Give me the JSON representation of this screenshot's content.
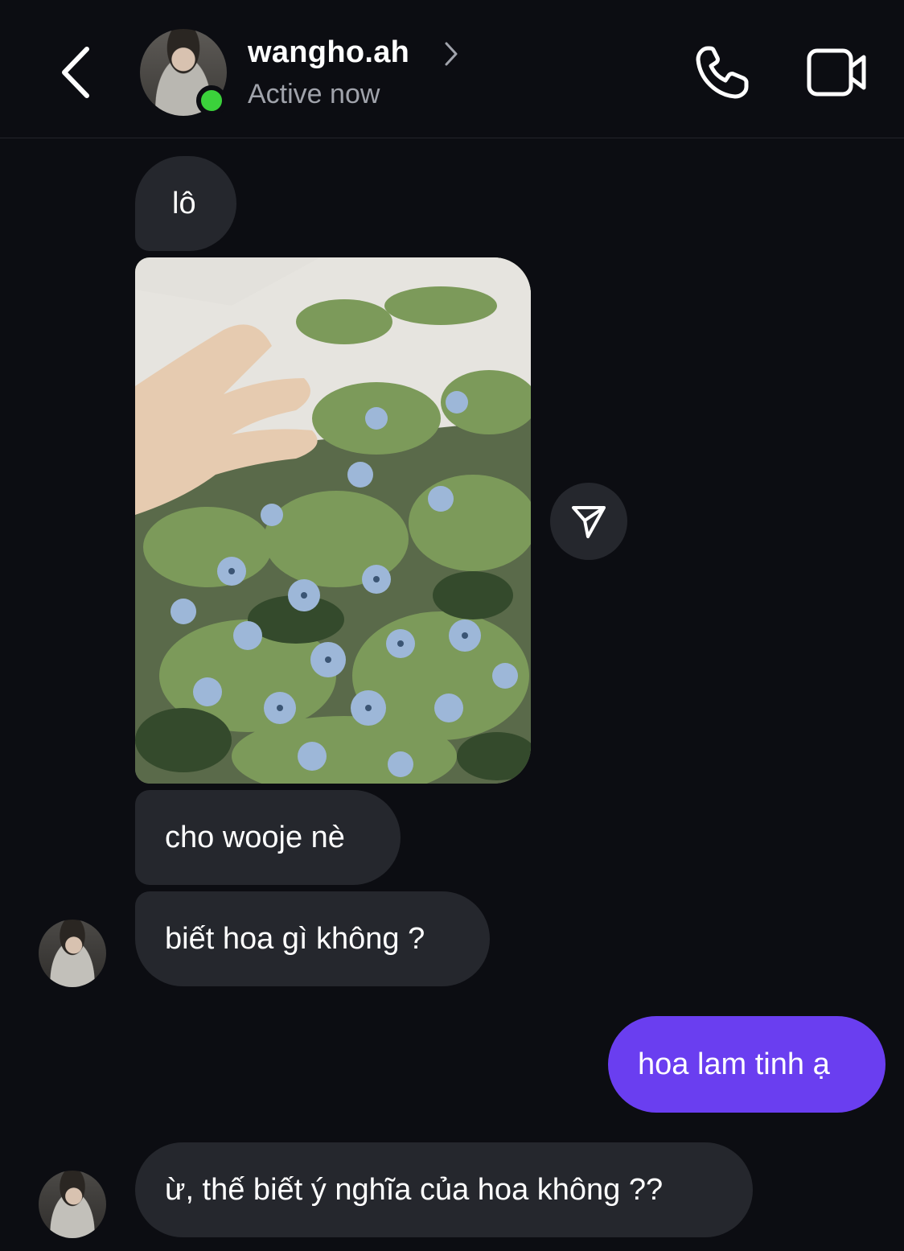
{
  "header": {
    "username": "wangho.ah",
    "status": "Active now",
    "icons": {
      "back": "chevron-left-icon",
      "profile": "chevron-right-icon",
      "call": "phone-icon",
      "video": "video-camera-icon"
    }
  },
  "messages": [
    {
      "from": "them",
      "text": "lô"
    },
    {
      "from": "them",
      "type": "photo",
      "alt": "photo of blue star flowers (Oxypetalum) with a hand"
    },
    {
      "from": "them",
      "text": "cho wooje nè"
    },
    {
      "from": "them",
      "text": "biết hoa gì không ?"
    },
    {
      "from": "me",
      "text": "hoa lam tinh ạ"
    },
    {
      "from": "them",
      "text": "ừ, thế biết ý nghĩa của hoa không ??"
    }
  ],
  "colors": {
    "background": "#0c0d12",
    "incoming_bubble": "#25272d",
    "outgoing_bubble": "#6a3ef0",
    "online": "#3bd13b"
  }
}
